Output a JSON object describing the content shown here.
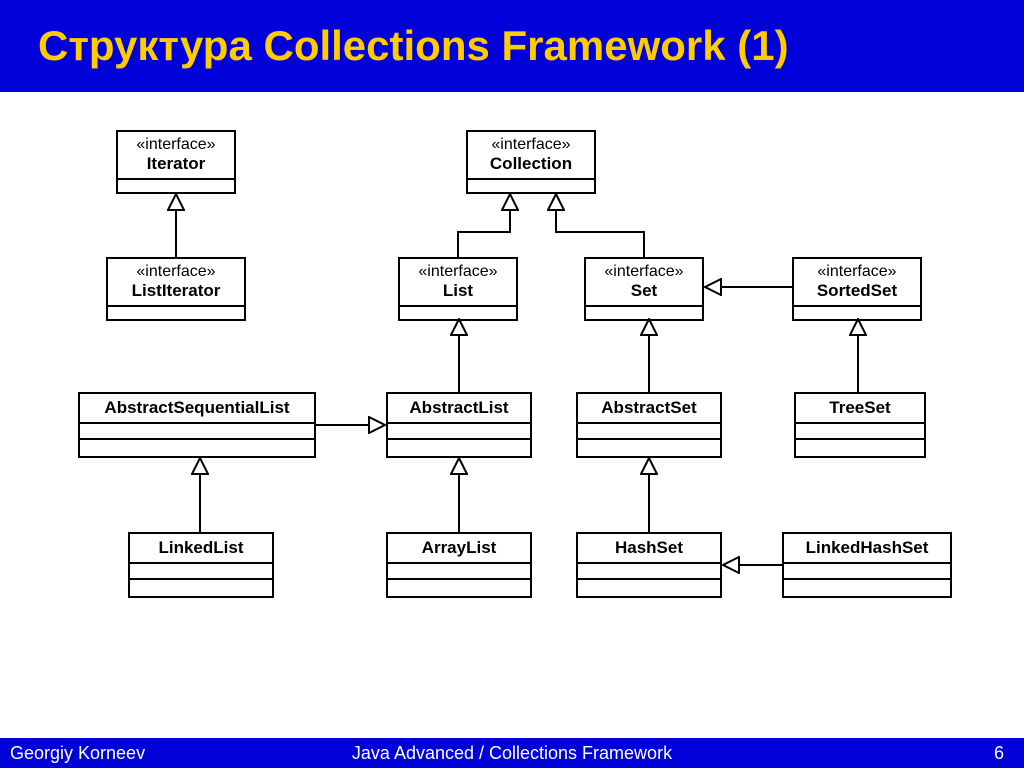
{
  "slide": {
    "title": "Структура Collections Framework (1)",
    "footer_author": "Georgiy Korneev",
    "footer_course": "Java Advanced / Collections Framework",
    "footer_page": "6",
    "stereotype": "«interface»"
  },
  "boxes": {
    "iterator": {
      "name": "Iterator",
      "stereo": true
    },
    "listiterator": {
      "name": "ListIterator",
      "stereo": true
    },
    "collection": {
      "name": "Collection",
      "stereo": true
    },
    "list": {
      "name": "List",
      "stereo": true
    },
    "set": {
      "name": "Set",
      "stereo": true
    },
    "sortedset": {
      "name": "SortedSet",
      "stereo": true
    },
    "absseqlist": {
      "name": "AbstractSequentialList",
      "stereo": false
    },
    "abstractlist": {
      "name": "AbstractList",
      "stereo": false
    },
    "abstractset": {
      "name": "AbstractSet",
      "stereo": false
    },
    "treeset": {
      "name": "TreeSet",
      "stereo": false
    },
    "linkedlist": {
      "name": "LinkedList",
      "stereo": false
    },
    "arraylist": {
      "name": "ArrayList",
      "stereo": false
    },
    "hashset": {
      "name": "HashSet",
      "stereo": false
    },
    "linkedhashset": {
      "name": "LinkedHashSet",
      "stereo": false
    }
  },
  "edges": [
    {
      "from": "listiterator",
      "to": "iterator"
    },
    {
      "from": "list",
      "to": "collection"
    },
    {
      "from": "set",
      "to": "collection"
    },
    {
      "from": "sortedset",
      "to": "set"
    },
    {
      "from": "abstractlist",
      "to": "list"
    },
    {
      "from": "abstractset",
      "to": "set"
    },
    {
      "from": "treeset",
      "to": "sortedset"
    },
    {
      "from": "absseqlist",
      "to": "abstractlist"
    },
    {
      "from": "linkedlist",
      "to": "absseqlist"
    },
    {
      "from": "arraylist",
      "to": "abstractlist"
    },
    {
      "from": "hashset",
      "to": "abstractset"
    },
    {
      "from": "linkedhashset",
      "to": "hashset"
    }
  ]
}
